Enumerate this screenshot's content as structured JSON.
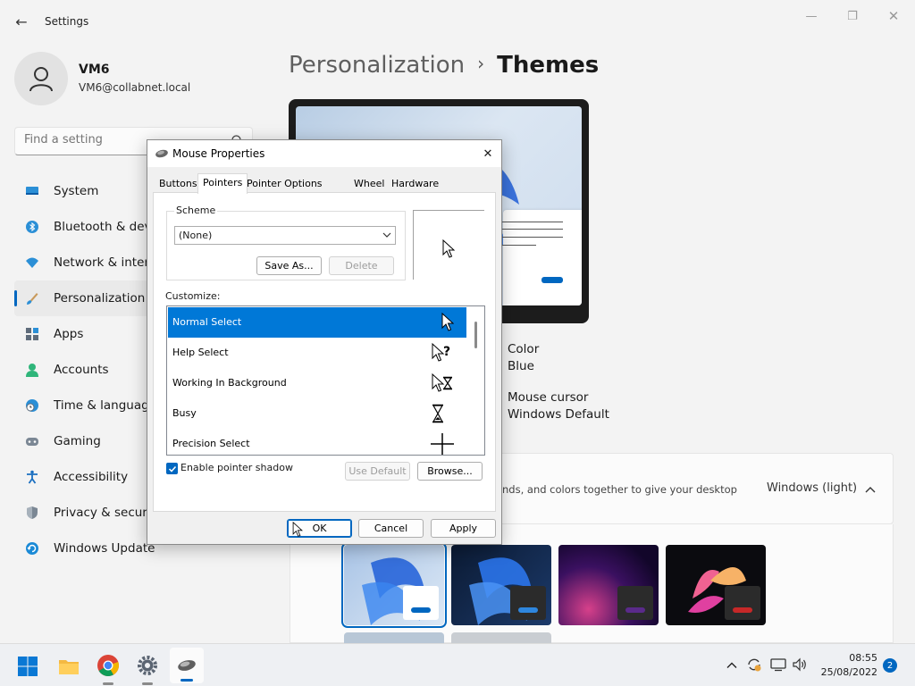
{
  "window": {
    "title": "Settings",
    "back_glyph": "←",
    "minimize_glyph": "—",
    "maximize_glyph": "❐",
    "close_glyph": "✕"
  },
  "profile": {
    "name": "VM6",
    "email": "VM6@collabnet.local"
  },
  "search": {
    "placeholder": "Find a setting"
  },
  "nav": {
    "items": [
      {
        "label": "System",
        "icon": "monitor-icon"
      },
      {
        "label": "Bluetooth & devi",
        "icon": "bluetooth-icon"
      },
      {
        "label": "Network & interr",
        "icon": "wifi-icon"
      },
      {
        "label": "Personalization",
        "icon": "brush-icon",
        "active": true
      },
      {
        "label": "Apps",
        "icon": "apps-icon"
      },
      {
        "label": "Accounts",
        "icon": "person-icon"
      },
      {
        "label": "Time & language",
        "icon": "clock-globe-icon"
      },
      {
        "label": "Gaming",
        "icon": "gamepad-icon"
      },
      {
        "label": "Accessibility",
        "icon": "accessibility-icon"
      },
      {
        "label": "Privacy & security",
        "icon": "shield-icon"
      },
      {
        "label": "Windows Update",
        "icon": "update-icon"
      }
    ]
  },
  "breadcrumb": {
    "parent": "Personalization",
    "separator": "›",
    "current": "Themes"
  },
  "theme_properties": {
    "color_label": "Color",
    "color_value": "Blue",
    "cursor_label": "Mouse cursor",
    "cursor_value": "Windows Default"
  },
  "current_theme": {
    "description": "nds, and colors together to give your desktop",
    "value": "Windows (light)"
  },
  "colors": {
    "accent": "#0067c0",
    "selection": "#0078d7"
  },
  "dialog": {
    "title": "Mouse Properties",
    "close_glyph": "✕",
    "tabs": [
      "Buttons",
      "Pointers",
      "Pointer Options",
      "Wheel",
      "Hardware"
    ],
    "active_tab": "Pointers",
    "scheme_label": "Scheme",
    "scheme_value": "(None)",
    "save_as": "Save As...",
    "delete": "Delete",
    "customize_label": "Customize:",
    "cursors": [
      {
        "name": "Normal Select",
        "icon": "arrow-cursor-icon",
        "selected": true
      },
      {
        "name": "Help Select",
        "icon": "help-cursor-icon"
      },
      {
        "name": "Working In Background",
        "icon": "working-cursor-icon"
      },
      {
        "name": "Busy",
        "icon": "hourglass-cursor-icon"
      },
      {
        "name": "Precision Select",
        "icon": "crosshair-cursor-icon"
      }
    ],
    "enable_shadow_label": "Enable pointer shadow",
    "enable_shadow_checked": true,
    "use_default": "Use Default",
    "browse": "Browse...",
    "ok": "OK",
    "cancel": "Cancel",
    "apply": "Apply"
  },
  "taskbar": {
    "apps": [
      "start-icon",
      "file-explorer-icon",
      "chrome-icon",
      "settings-icon",
      "mouse-icon"
    ],
    "time": "08:55",
    "date": "25/08/2022",
    "notification_count": "2"
  }
}
